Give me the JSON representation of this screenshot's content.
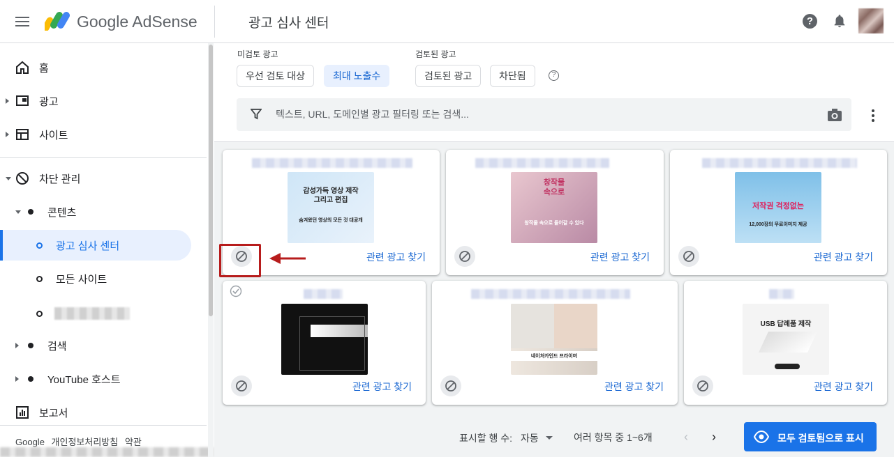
{
  "header": {
    "brand": "Google AdSense",
    "page_title": "광고 심사 센터",
    "help_icon": "help-circle-icon",
    "bell_icon": "notifications-icon"
  },
  "sidebar": {
    "items": [
      {
        "label": "홈",
        "icon": "home-icon"
      },
      {
        "label": "광고",
        "icon": "ads-icon"
      },
      {
        "label": "사이트",
        "icon": "sites-icon"
      },
      {
        "label": "차단 관리",
        "icon": "block-icon"
      },
      {
        "label": "콘텐츠"
      },
      {
        "label": "광고 심사 센터"
      },
      {
        "label": "모든 사이트"
      },
      {
        "label": "검색"
      },
      {
        "label": "YouTube 호스트"
      },
      {
        "label": "보고서",
        "icon": "reports-icon"
      }
    ],
    "footer": [
      "Google",
      "개인정보처리방침",
      "약관"
    ]
  },
  "filters": {
    "unreviewed_label": "미검토 광고",
    "reviewed_label": "검토된 광고",
    "chips": [
      "우선 검토 대상",
      "최대 노출수",
      "검토된 광고",
      "차단됨"
    ],
    "search_placeholder": "텍스트, URL, 도메인별 광고 필터링 또는 검색..."
  },
  "cards": {
    "find_related": "관련 광고 찾기",
    "items": [
      {
        "headline1": "감성가득 영상 제작",
        "headline2": "그리고 편집",
        "caption": "숨겨왔던 영상의 모든 것 대공개"
      },
      {
        "headline1": "창작물",
        "headline2": "속으로",
        "caption": "창작물 속으로 들어갈 수 있다"
      },
      {
        "headline1": "저작권 걱정없는",
        "headline2": "",
        "caption": "12,000장의 무료이미지 제공"
      },
      {
        "headline1": "",
        "headline2": "",
        "caption": ""
      },
      {
        "headline1": "",
        "headline2": "",
        "caption": "네이처카인드 프라이머"
      },
      {
        "headline1": "USB 답례품 제작",
        "headline2": "",
        "caption": ""
      }
    ]
  },
  "footer": {
    "rows_label": "표시할 행 수:",
    "rows_value": "자동",
    "range": "여러 항목 중 1~6개",
    "review_all": "모두 검토됨으로 표시"
  },
  "colors": {
    "accent": "#1a73e8",
    "highlight": "#b71c1c"
  }
}
